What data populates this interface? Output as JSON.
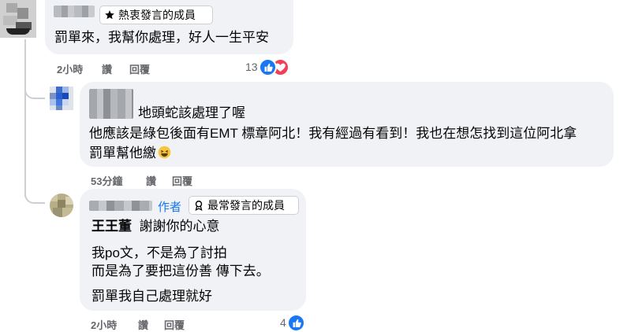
{
  "comments": [
    {
      "badge_label": "熱衷發言的成員",
      "badge_icon": "star-icon",
      "lines": [
        "罰單來，我幫你處理，好人一生平安"
      ],
      "time": "2小時",
      "like_label": "讚",
      "reply_label": "回覆",
      "reaction_count": "13",
      "reactions": [
        "like-icon",
        "love-icon"
      ]
    },
    {
      "first_line_text": "地頭蛇該處理了喔",
      "lines": [
        "他應該是綠包後面有EMT 標章阿北！我有經過有看到！我也在想怎找到這位阿北拿",
        "罰單幫他繳"
      ],
      "emoji": "laughing-emoji-icon",
      "time": "53分鐘",
      "like_label": "讚",
      "reply_label": "回覆"
    },
    {
      "author_label": "作者",
      "badge_label": "最常發言的成員",
      "badge_icon": "top-contributor-icon",
      "tag": "王王董",
      "tag_text": "謝謝你的心意",
      "lines": [
        "我po文，不是為了討拍",
        "而是為了要把這份善 傳下去。",
        "罰單我自己處理就好"
      ],
      "time": "2小時",
      "like_label": "讚",
      "reply_label": "回覆",
      "reaction_count": "4",
      "reactions": [
        "like-icon"
      ]
    }
  ],
  "colors": {
    "bubble": "#f0f2f5",
    "meta_text": "#65676b",
    "link_blue": "#1877f2",
    "love_red": "#f33e58"
  }
}
